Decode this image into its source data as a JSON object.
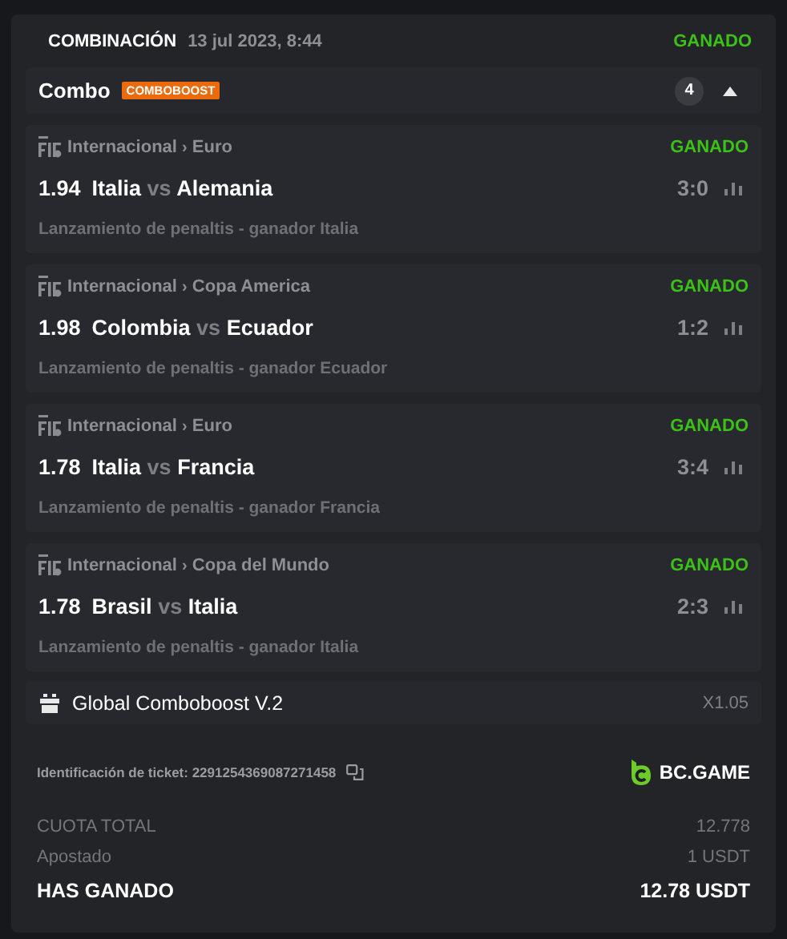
{
  "header": {
    "title": "COMBINACIÓN",
    "date": "13 jul 2023, 8:44",
    "status": "GANADO",
    "won": true
  },
  "combo": {
    "title": "Combo",
    "badge": "COMBOBOOST",
    "count": "4",
    "expanded": true
  },
  "legs": [
    {
      "category": "Internacional",
      "separator": "›",
      "league": "Euro",
      "status": "GANADO",
      "won": true,
      "odds": "1.94",
      "home": "Italia",
      "vs": "vs",
      "away": "Alemania",
      "score": "3:0",
      "market": "Lanzamiento de penaltis - ganador Italia"
    },
    {
      "category": "Internacional",
      "separator": "›",
      "league": "Copa America",
      "status": "GANADO",
      "won": true,
      "odds": "1.98",
      "home": "Colombia",
      "vs": "vs",
      "away": "Ecuador",
      "score": "1:2",
      "market": "Lanzamiento de penaltis - ganador Ecuador"
    },
    {
      "category": "Internacional",
      "separator": "›",
      "league": "Euro",
      "status": "GANADO",
      "won": true,
      "odds": "1.78",
      "home": "Italia",
      "vs": "vs",
      "away": "Francia",
      "score": "3:4",
      "market": "Lanzamiento de penaltis - ganador Francia"
    },
    {
      "category": "Internacional",
      "separator": "›",
      "league": "Copa del Mundo",
      "status": "GANADO",
      "won": true,
      "odds": "1.78",
      "home": "Brasil",
      "vs": "vs",
      "away": "Italia",
      "score": "2:3",
      "market": "Lanzamiento de penaltis - ganador Italia"
    }
  ],
  "boost": {
    "label": "Global Comboboost V.2",
    "multiplier": "X1.05"
  },
  "ticket": {
    "label": "Identificación de ticket: 2291254369087271458",
    "brand": "BC.GAME"
  },
  "totals": [
    {
      "label": "CUOTA TOTAL",
      "value": "12.778",
      "kind": "normal"
    },
    {
      "label": "Apostado",
      "value": "1 USDT",
      "kind": "normal"
    },
    {
      "label": "HAS GANADO",
      "value": "12.78 USDT",
      "kind": "strong"
    }
  ]
}
